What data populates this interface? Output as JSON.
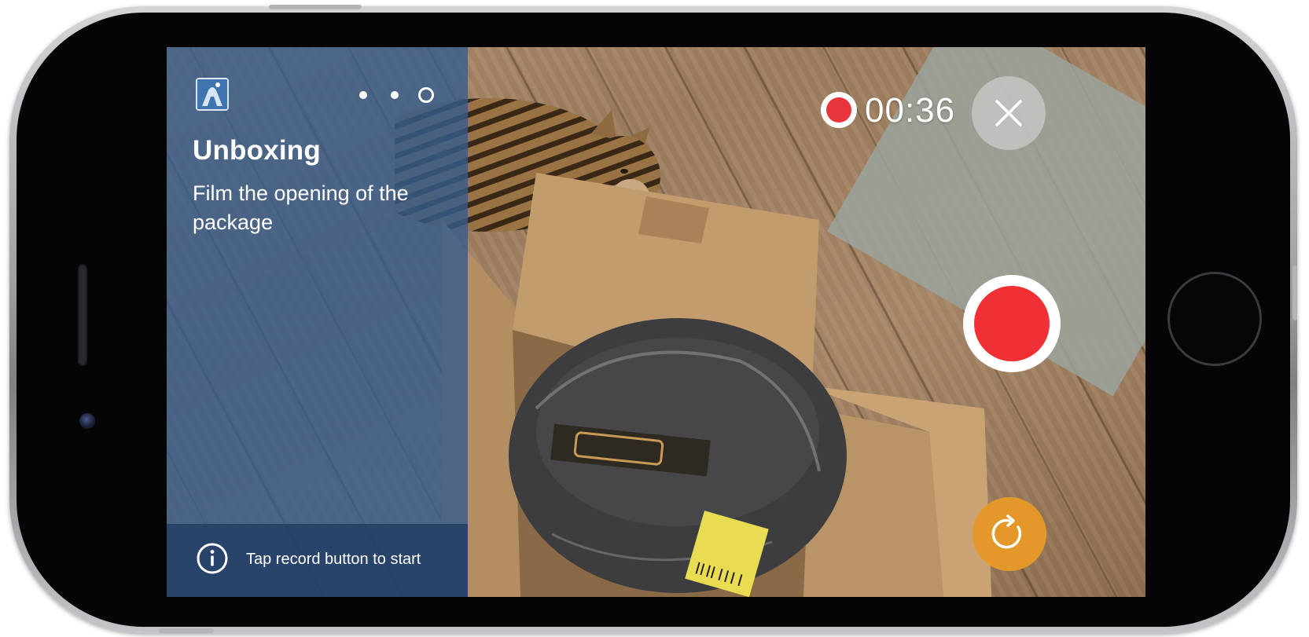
{
  "panel": {
    "title": "Unboxing",
    "description": "Film the opening of the package",
    "hint": "Tap record button to start",
    "page_indicator": {
      "total": 3,
      "current": 3
    }
  },
  "recording": {
    "timer": "00:36"
  },
  "icons": {
    "app_logo": "app-logo-icon",
    "info": "info-icon",
    "close": "close-icon",
    "record": "record-icon",
    "reset": "rotate-icon"
  },
  "colors": {
    "panel": "#345c8e",
    "record": "#f03035",
    "reset": "#e5982a"
  }
}
